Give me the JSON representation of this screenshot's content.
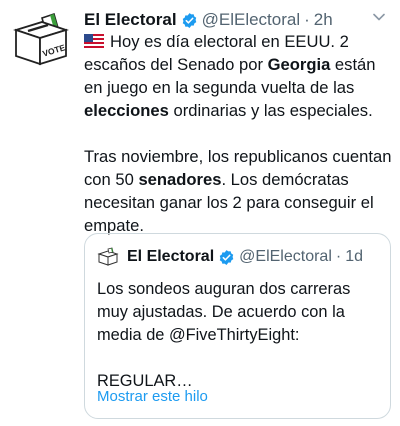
{
  "tweet": {
    "author_name": "El Electoral",
    "handle": "@ElElectoral",
    "separator": "·",
    "time": "2h",
    "avatar_text": "VOTE",
    "text": {
      "p1_a": "Hoy es día electoral en EEUU. 2 escaños del Senado por ",
      "p1_b": "Georgia",
      "p1_c": " están en juego en la segunda vuelta de las ",
      "p1_d": "elecciones",
      "p1_e": " ordinarias y las especiales.",
      "p2_a": "Tras noviembre, los republicanos cuentan con 50 ",
      "p2_b": "senadores",
      "p2_c": ". Los demócratas necesitan ganar los 2 para conseguir el empate."
    }
  },
  "quoted": {
    "author_name": "El Electoral",
    "handle": "@ElElectoral",
    "separator": "·",
    "time": "1d",
    "p1": "Los sondeos auguran dos carreras muy ajustadas. De acuerdo con la media de @FiveThirtyEight:",
    "p2": "REGULAR…",
    "show_thread": "Mostrar este hilo"
  },
  "icons": {
    "verified": "verified-badge-icon",
    "more": "chevron-down-icon",
    "flag": "us-flag-icon",
    "avatar": "ballot-box-icon"
  },
  "colors": {
    "link": "#1d9bf0",
    "verified": "#1d9bf0",
    "muted": "#536471",
    "border": "#cfd9de"
  }
}
